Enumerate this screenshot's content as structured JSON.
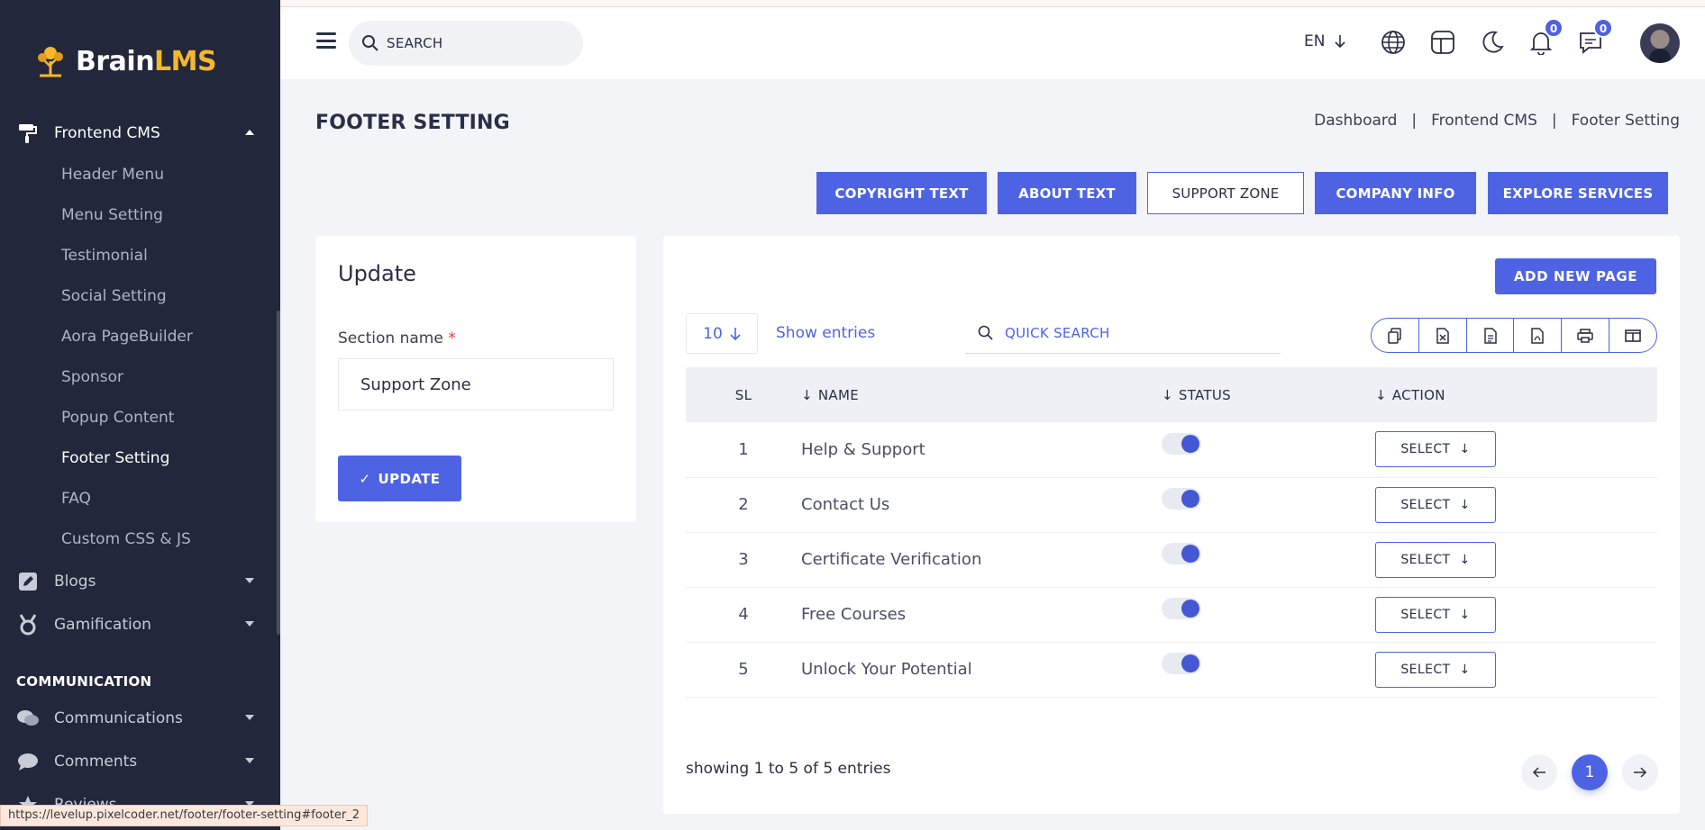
{
  "brand": {
    "name_main": "Brain",
    "name_accent": "LMS"
  },
  "sidebar": {
    "frontend_cms": {
      "label": "Frontend CMS"
    },
    "frontend_items": [
      {
        "label": "Header Menu"
      },
      {
        "label": "Menu Setting"
      },
      {
        "label": "Testimonial"
      },
      {
        "label": "Social Setting"
      },
      {
        "label": "Aora PageBuilder"
      },
      {
        "label": "Sponsor"
      },
      {
        "label": "Popup Content"
      },
      {
        "label": "Footer Setting",
        "active": true
      },
      {
        "label": "FAQ"
      },
      {
        "label": "Custom CSS & JS"
      }
    ],
    "blogs": {
      "label": "Blogs"
    },
    "gamification": {
      "label": "Gamification"
    },
    "section_heading": "COMMUNICATION",
    "communications": {
      "label": "Communications"
    },
    "comments": {
      "label": "Comments"
    },
    "reviews": {
      "label": "Reviews"
    }
  },
  "status_bar": {
    "url": "https://levelup.pixelcoder.net/footer/footer-setting#footer_2"
  },
  "topbar": {
    "search_placeholder": "SEARCH",
    "language": "EN",
    "notifications_count": "0",
    "messages_count": "0"
  },
  "page": {
    "title": "FOOTER SETTING",
    "breadcrumb": [
      "Dashboard",
      "Frontend CMS",
      "Footer Setting"
    ],
    "breadcrumb_sep": "|"
  },
  "tabs": [
    {
      "label": "COPYRIGHT TEXT",
      "active": false
    },
    {
      "label": "ABOUT TEXT",
      "active": false
    },
    {
      "label": "SUPPORT ZONE",
      "active": true
    },
    {
      "label": "COMPANY INFO",
      "active": false
    },
    {
      "label": "EXPLORE SERVICES",
      "active": false
    }
  ],
  "update_card": {
    "title": "Update",
    "field_label": "Section name",
    "required_mark": "*",
    "field_value": "Support Zone",
    "button_label": "UPDATE",
    "button_check": "✓"
  },
  "table_card": {
    "add_button": "ADD NEW PAGE",
    "entries_value": "10",
    "entries_label": "Show entries",
    "quick_search_placeholder": "QUICK SEARCH",
    "export_icons": [
      "copy-icon",
      "excel-icon",
      "csv-icon",
      "pdf-icon",
      "print-icon",
      "columns-icon"
    ],
    "columns": {
      "sl": "SL",
      "name": "NAME",
      "status": "STATUS",
      "action": "ACTION"
    },
    "rows": [
      {
        "sl": "1",
        "name": "Help & Support",
        "status": true,
        "action": "SELECT"
      },
      {
        "sl": "2",
        "name": "Contact Us",
        "status": true,
        "action": "SELECT"
      },
      {
        "sl": "3",
        "name": "Certificate Verification",
        "status": true,
        "action": "SELECT"
      },
      {
        "sl": "4",
        "name": "Free Courses",
        "status": true,
        "action": "SELECT"
      },
      {
        "sl": "5",
        "name": "Unlock Your Potential",
        "status": true,
        "action": "SELECT"
      }
    ],
    "showing_text": "showing 1 to 5 of 5 entries",
    "current_page": "1"
  },
  "colors": {
    "accent": "#4e63e3",
    "sidebar_bg": "#23273b",
    "brand_accent": "#f5b72b"
  }
}
